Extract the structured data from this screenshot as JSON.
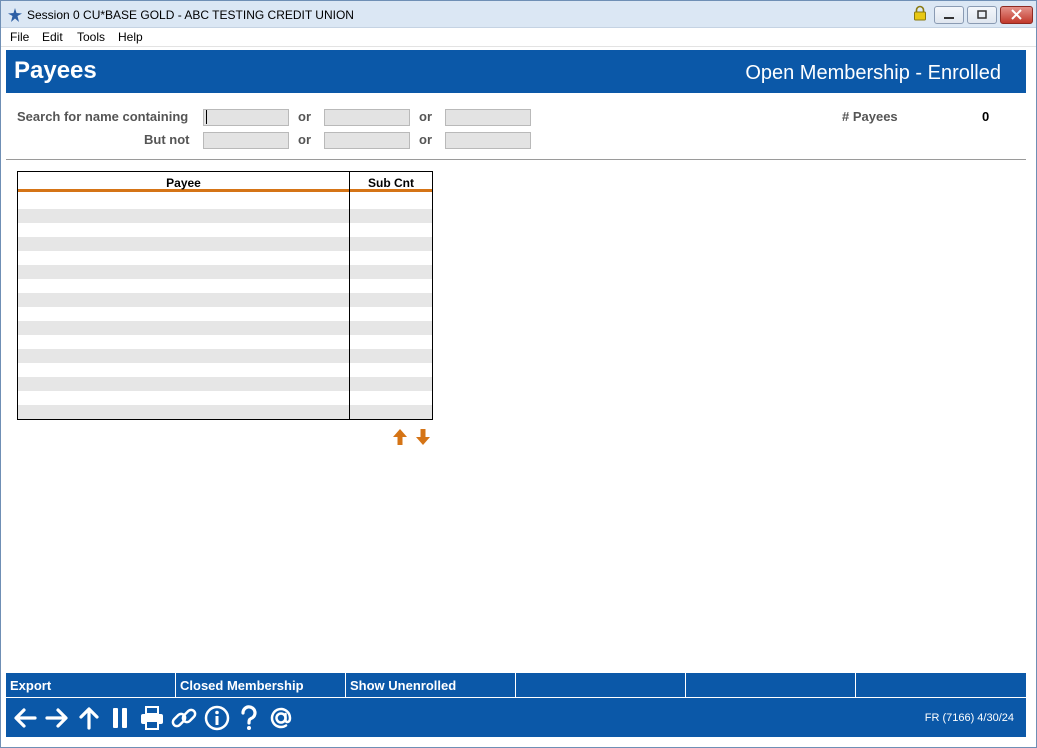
{
  "window": {
    "title": "Session 0 CU*BASE GOLD - ABC TESTING CREDIT UNION"
  },
  "menu": [
    "File",
    "Edit",
    "Tools",
    "Help"
  ],
  "header": {
    "title": "Payees",
    "subtitle": "Open Membership - Enrolled"
  },
  "search": {
    "label_containing": "Search for name containing",
    "label_but_not": "But not",
    "or_label": "or",
    "containing_values": [
      "",
      "",
      ""
    ],
    "but_not_values": [
      "",
      "",
      ""
    ]
  },
  "payee_count": {
    "label": "# Payees",
    "value": "0"
  },
  "grid": {
    "columns": [
      "Payee",
      "Sub Cnt"
    ],
    "rows": []
  },
  "actions": [
    "Export",
    "Closed Membership",
    "Show Unenrolled",
    "",
    "",
    ""
  ],
  "toolbar_icons": [
    "back-arrow-icon",
    "forward-arrow-icon",
    "up-arrow-icon",
    "pause-icon",
    "printer-icon",
    "link-icon",
    "info-icon",
    "help-icon",
    "at-sign-icon"
  ],
  "status": {
    "text": "FR (7166) 4/30/24"
  },
  "colors": {
    "brand_blue": "#0b58a8",
    "accent_orange": "#d57416"
  }
}
